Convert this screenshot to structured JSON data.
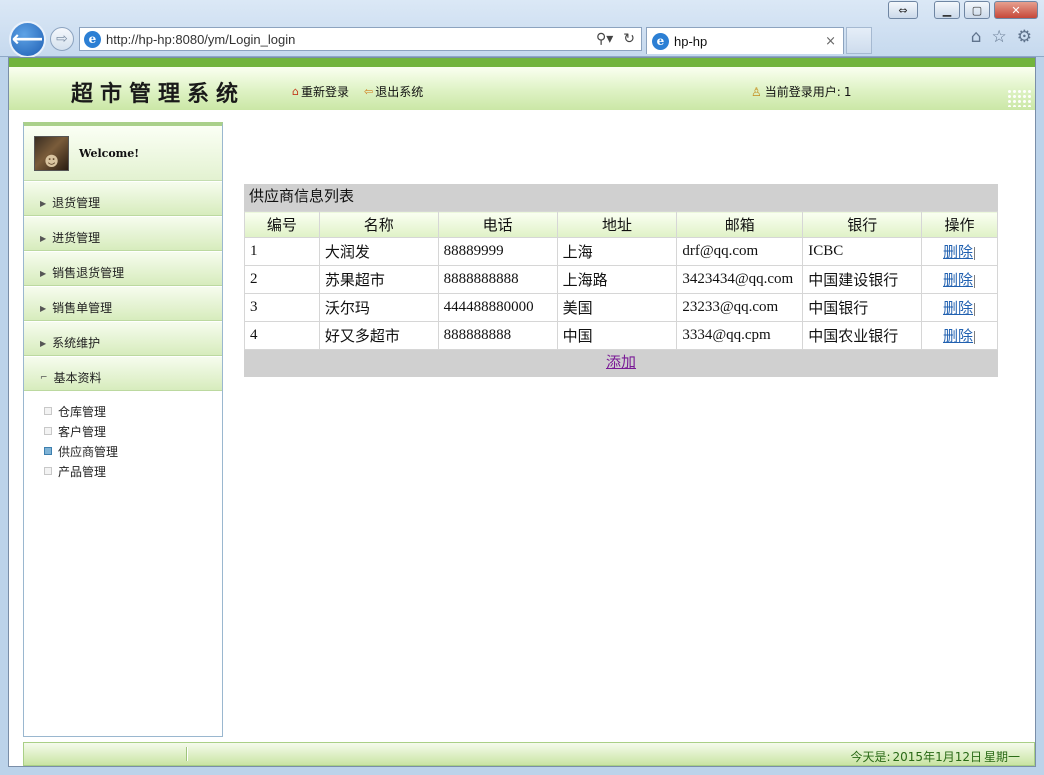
{
  "browser": {
    "url": "http://hp-hp:8080/ym/Login_login",
    "tab_title": "hp-hp",
    "tab_close": "×"
  },
  "header": {
    "app_title": "超市管理系统",
    "relogin_label": "重新登录",
    "logout_label": "退出系统",
    "current_user_label": "当前登录用户:",
    "current_user": "1"
  },
  "sidebar": {
    "welcome": "Welcome!",
    "menu": [
      {
        "label": "退货管理"
      },
      {
        "label": "进货管理"
      },
      {
        "label": "销售退货管理"
      },
      {
        "label": "销售单管理"
      },
      {
        "label": "系统维护"
      },
      {
        "label": "基本资料"
      }
    ],
    "submenu": [
      {
        "label": "仓库管理"
      },
      {
        "label": "客户管理"
      },
      {
        "label": "供应商管理"
      },
      {
        "label": "产品管理"
      }
    ]
  },
  "main": {
    "list_title": "供应商信息列表",
    "columns": [
      "编号",
      "名称",
      "电话",
      "地址",
      "邮箱",
      "银行",
      "操作"
    ],
    "rows": [
      {
        "id": "1",
        "name": "大润发",
        "phone": "88889999",
        "address": "上海",
        "email": "drf@qq.com",
        "bank": "ICBC",
        "action": "删除"
      },
      {
        "id": "2",
        "name": "苏果超市",
        "phone": "8888888888",
        "address": "上海路",
        "email": "3423434@qq.com",
        "bank": "中国建设银行",
        "action": "删除"
      },
      {
        "id": "3",
        "name": "沃尔玛",
        "phone": "444488880000",
        "address": "美国",
        "email": "23233@qq.com",
        "bank": "中国银行",
        "action": "删除"
      },
      {
        "id": "4",
        "name": "好又多超市",
        "phone": "888888888",
        "address": "中国",
        "email": "3334@qq.cpm",
        "bank": "中国农业银行",
        "action": "删除"
      }
    ],
    "add_label": "添加"
  },
  "footer": {
    "today_label": "今天是:",
    "date": "2015年1月12日",
    "weekday": "星期一"
  },
  "colors": {
    "header_bar": "#72b43d",
    "link": "#2060b0",
    "add_link": "#7a1a96"
  }
}
